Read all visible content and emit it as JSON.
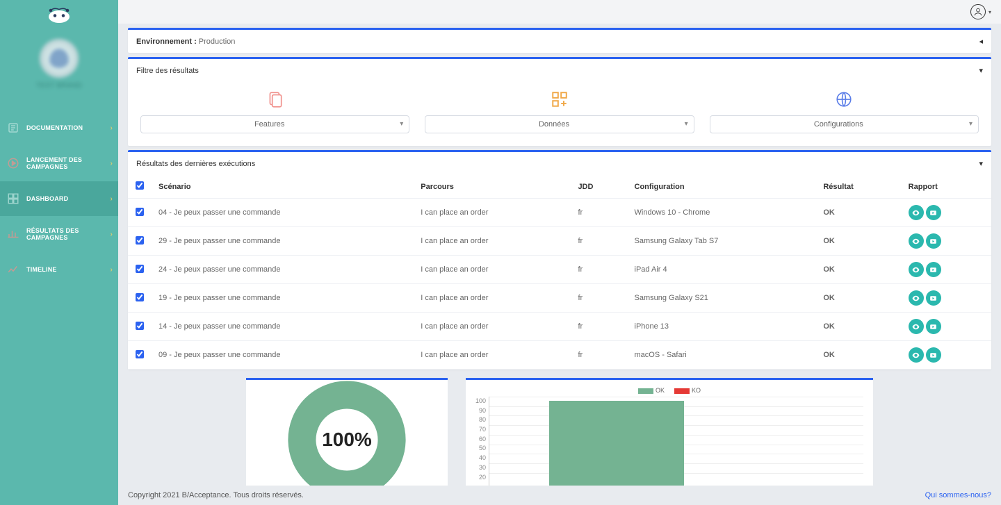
{
  "sidebar": {
    "avatar_label": "TEST BRAND",
    "items": [
      {
        "label": "DOCUMENTATION"
      },
      {
        "label": "LANCEMENT DES CAMPAGNES"
      },
      {
        "label": "DASHBOARD"
      },
      {
        "label": "RÉSULTATS DES CAMPAGNES"
      },
      {
        "label": "TIMELINE"
      }
    ]
  },
  "env": {
    "label": "Environnement :",
    "value": "Production"
  },
  "filters": {
    "title": "Filtre des résultats",
    "cols": [
      {
        "label": "Features"
      },
      {
        "label": "Données"
      },
      {
        "label": "Configurations"
      }
    ]
  },
  "results": {
    "title": "Résultats des dernières exécutions",
    "headers": {
      "scenario": "Scénario",
      "parcours": "Parcours",
      "jdd": "JDD",
      "config": "Configuration",
      "resultat": "Résultat",
      "rapport": "Rapport"
    },
    "rows": [
      {
        "scenario": "04 - Je peux passer une commande",
        "parcours": "I can place an order",
        "jdd": "fr",
        "config": "Windows 10 - Chrome",
        "resultat": "OK"
      },
      {
        "scenario": "29 - Je peux passer une commande",
        "parcours": "I can place an order",
        "jdd": "fr",
        "config": "Samsung Galaxy Tab S7",
        "resultat": "OK"
      },
      {
        "scenario": "24 - Je peux passer une commande",
        "parcours": "I can place an order",
        "jdd": "fr",
        "config": "iPad Air 4",
        "resultat": "OK"
      },
      {
        "scenario": "19 - Je peux passer une commande",
        "parcours": "I can place an order",
        "jdd": "fr",
        "config": "Samsung Galaxy S21",
        "resultat": "OK"
      },
      {
        "scenario": "14 - Je peux passer une commande",
        "parcours": "I can place an order",
        "jdd": "fr",
        "config": "iPhone 13",
        "resultat": "OK"
      },
      {
        "scenario": "09 - Je peux passer une commande",
        "parcours": "I can place an order",
        "jdd": "fr",
        "config": "macOS - Safari",
        "resultat": "OK"
      }
    ]
  },
  "chart_data": [
    {
      "type": "pie",
      "title": "",
      "center_label": "100%",
      "series": [
        {
          "name": "OK",
          "value": 100,
          "color": "#74b392"
        },
        {
          "name": "KO",
          "value": 0,
          "color": "#e53935"
        }
      ]
    },
    {
      "type": "bar",
      "title": "",
      "legend": [
        {
          "name": "OK",
          "color": "#74b392"
        },
        {
          "name": "KO",
          "color": "#e53935"
        }
      ],
      "ylim": [
        0,
        100
      ],
      "yticks": [
        100,
        90,
        80,
        70,
        60,
        50,
        40,
        30,
        20
      ],
      "categories": [
        ""
      ],
      "series": [
        {
          "name": "OK",
          "values": [
            100
          ]
        },
        {
          "name": "KO",
          "values": [
            0
          ]
        }
      ]
    }
  ],
  "footer": {
    "copyright": "Copyright 2021 B/Acceptance. Tous droits réservés.",
    "link": "Qui sommes-nous?"
  }
}
